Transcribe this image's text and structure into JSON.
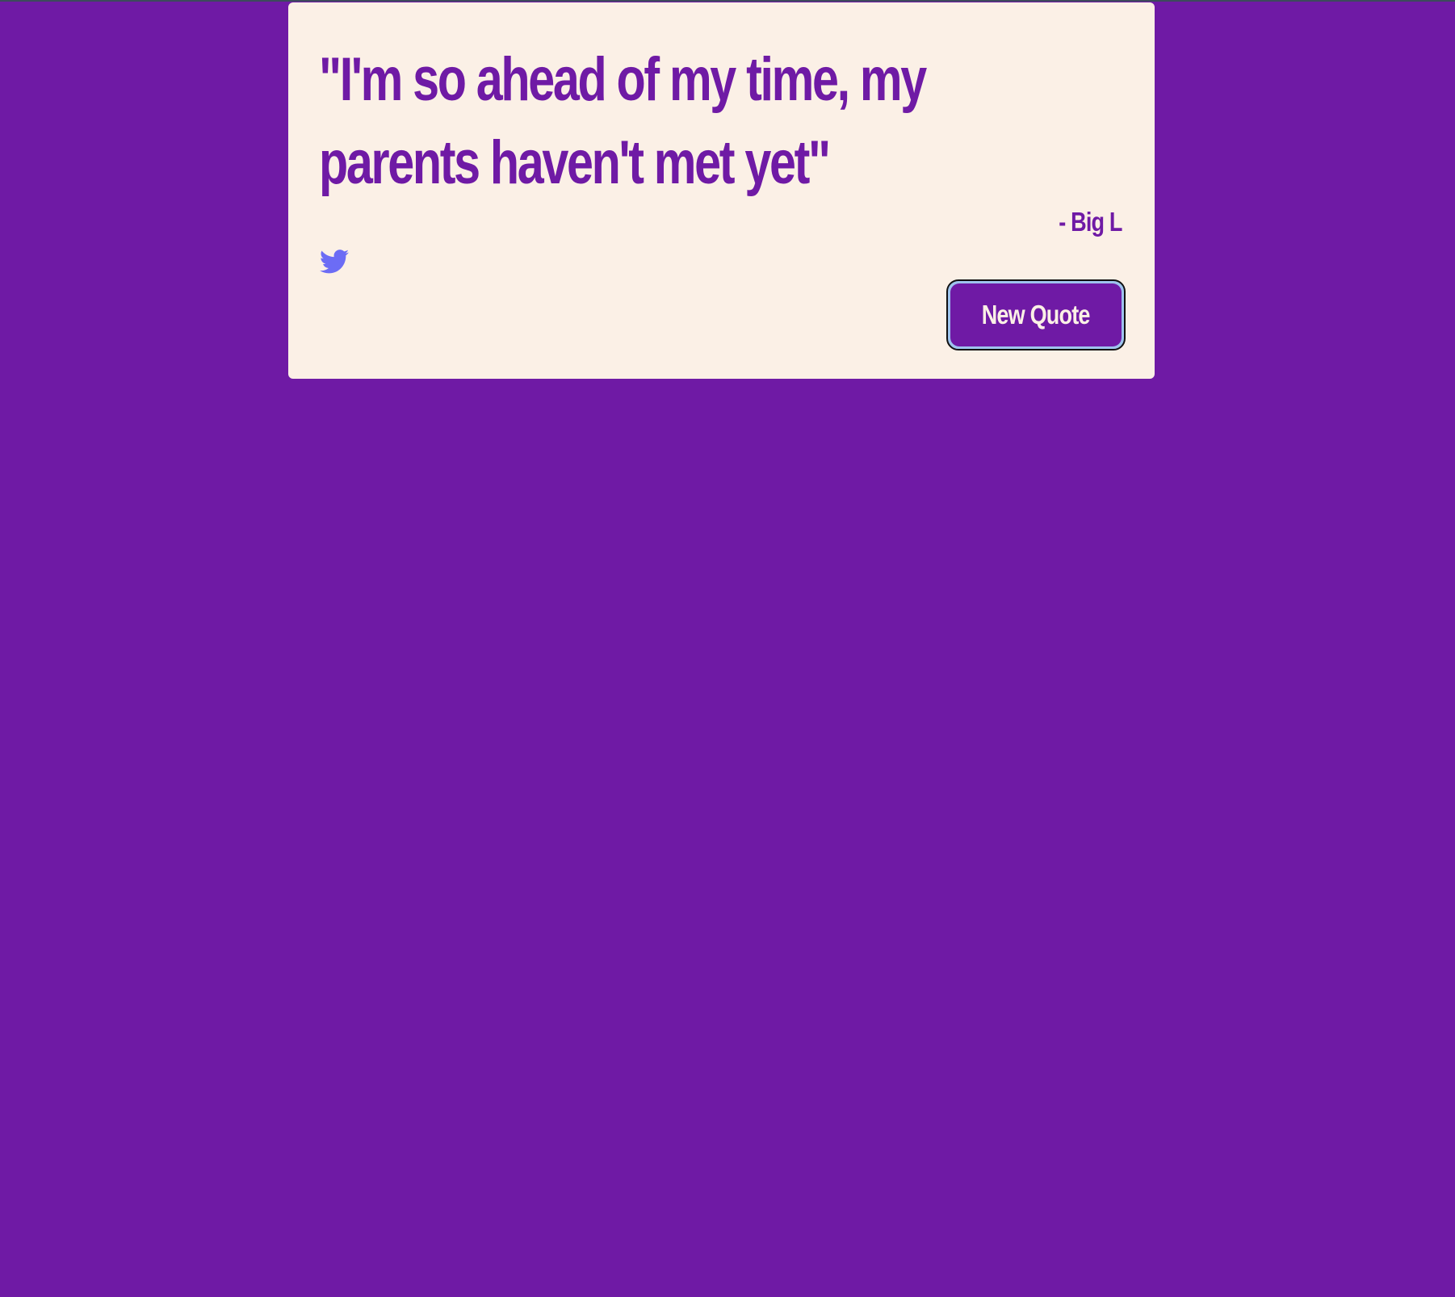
{
  "quote_box": {
    "text": "\"I'm so ahead of my time, my parents haven't met yet\"",
    "author": "- Big L",
    "tweet_icon": "twitter-bird-icon",
    "new_quote_label": "New Quote"
  },
  "colors": {
    "background": "#6f1aa5",
    "card": "#fbf0e6",
    "accent_text": "#6f1aa5",
    "twitter_icon": "#6c6cf5",
    "button_ring": "#9ec3ee",
    "button_text": "#fbf0e6"
  }
}
